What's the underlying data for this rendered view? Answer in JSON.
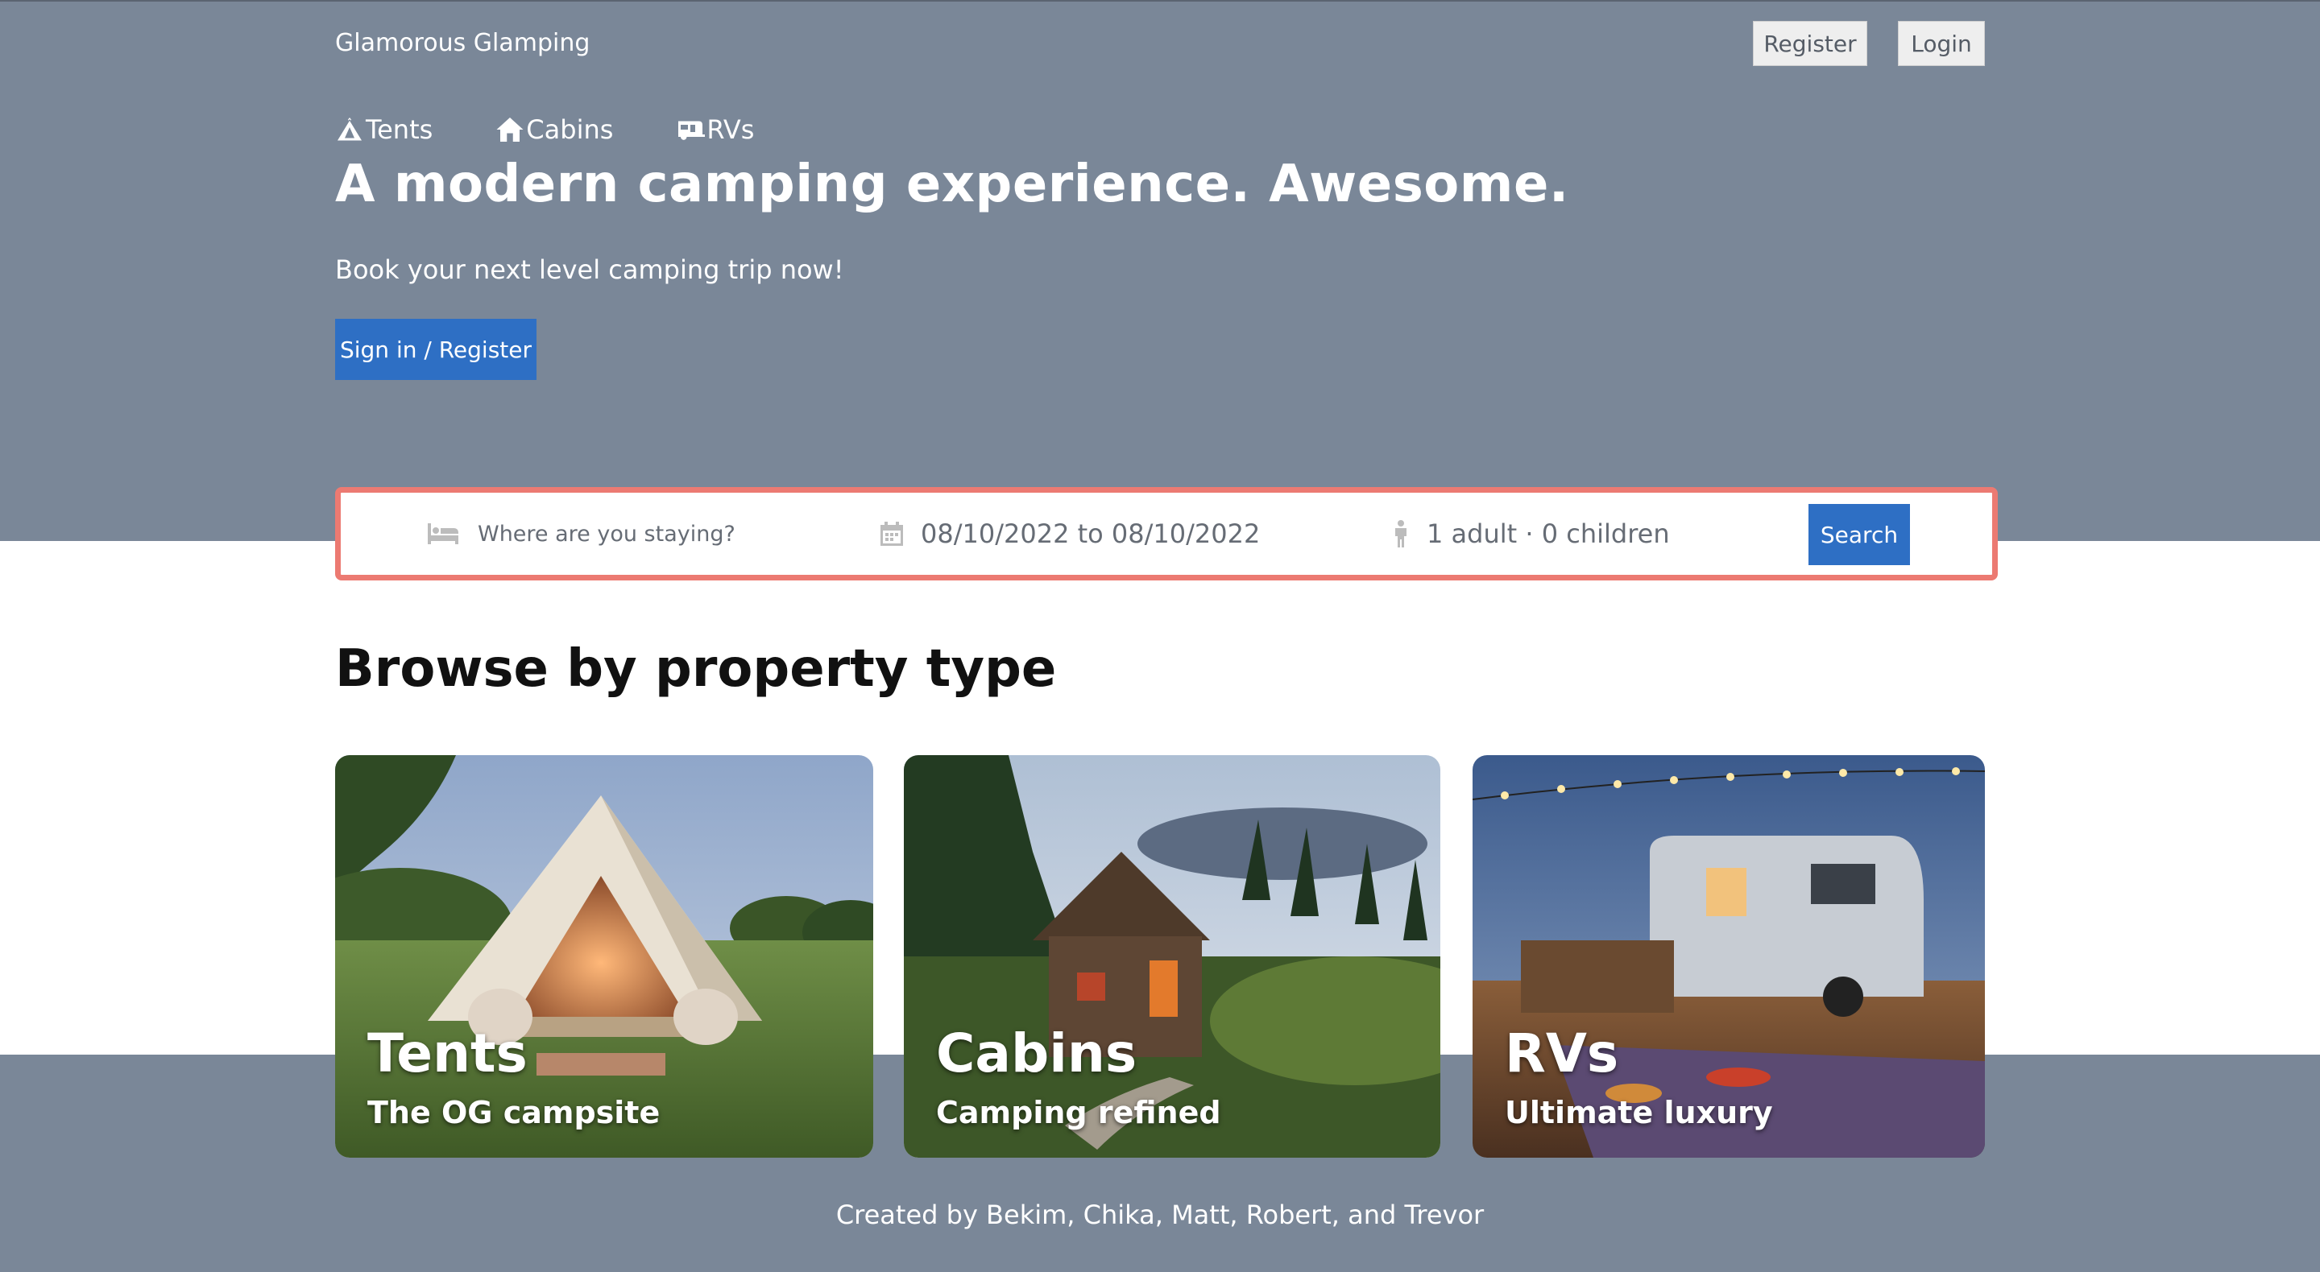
{
  "header": {
    "brand": "Glamorous Glamping",
    "register_label": "Register",
    "login_label": "Login"
  },
  "nav": {
    "items": [
      {
        "label": "Tents",
        "icon": "tent-icon"
      },
      {
        "label": "Cabins",
        "icon": "house-icon"
      },
      {
        "label": "RVs",
        "icon": "caravan-icon"
      }
    ]
  },
  "hero": {
    "headline": "A modern camping experience. Awesome.",
    "subline": "Book your next level camping trip now!",
    "cta_label": "Sign in / Register"
  },
  "search": {
    "destination_placeholder": "Where are you staying?",
    "dates": "08/10/2022 to 08/10/2022",
    "guests": "1 adult · 0 children",
    "button_label": "Search"
  },
  "browse": {
    "heading": "Browse by property type",
    "cards": [
      {
        "title": "Tents",
        "subtitle": "The OG campsite"
      },
      {
        "title": "Cabins",
        "subtitle": "Camping refined"
      },
      {
        "title": "RVs",
        "subtitle": "Ultimate luxury"
      }
    ]
  },
  "footer": {
    "credits": "Created by Bekim, Chika, Matt, Robert, and Trevor"
  },
  "colors": {
    "hero_bg": "#7a8798",
    "accent_blue": "#2e6fc4",
    "search_border": "#ec7a72"
  }
}
